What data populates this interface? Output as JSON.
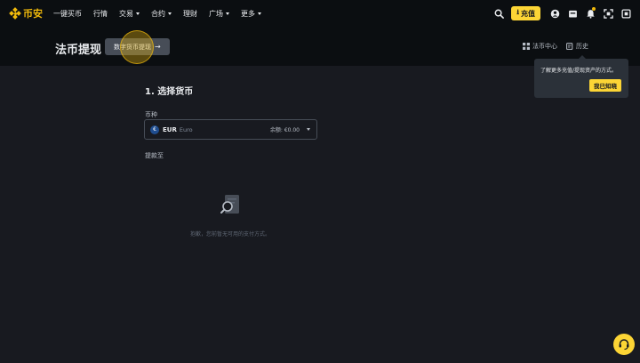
{
  "header": {
    "brand": "币安",
    "nav": [
      {
        "label": "一键买币",
        "has_caret": false
      },
      {
        "label": "行情",
        "has_caret": false
      },
      {
        "label": "交易",
        "has_caret": true
      },
      {
        "label": "合约",
        "has_caret": true
      },
      {
        "label": "理财",
        "has_caret": false
      },
      {
        "label": "广场",
        "has_caret": true
      },
      {
        "label": "更多",
        "has_caret": true
      }
    ],
    "deposit_label": "充值",
    "icons": [
      "search-icon",
      "download-icon",
      "user-icon",
      "wallet-icon",
      "bell-icon",
      "scan-icon",
      "fullscreen-icon"
    ]
  },
  "subheader": {
    "title": "法币提现",
    "crypto_withdraw_label": "数字货币提现",
    "fiat_center_label": "法币中心",
    "history_label": "历史"
  },
  "tooltip": {
    "text": "了解更多充值/提现资产的方式。",
    "button": "我已知晓"
  },
  "main": {
    "step_title": "1. 选择货币",
    "currency_label": "币种",
    "currency": {
      "symbol": "€",
      "code": "EUR",
      "name": "Euro",
      "balance": "余额: €0.00"
    },
    "withdraw_to_label": "提款至",
    "empty_text": "抱歉，您前暂无可用的支付方式。"
  },
  "colors": {
    "accent": "#fcd535",
    "brand": "#f0b90b",
    "background": "#181a20",
    "header_bg": "#0b0e11"
  }
}
